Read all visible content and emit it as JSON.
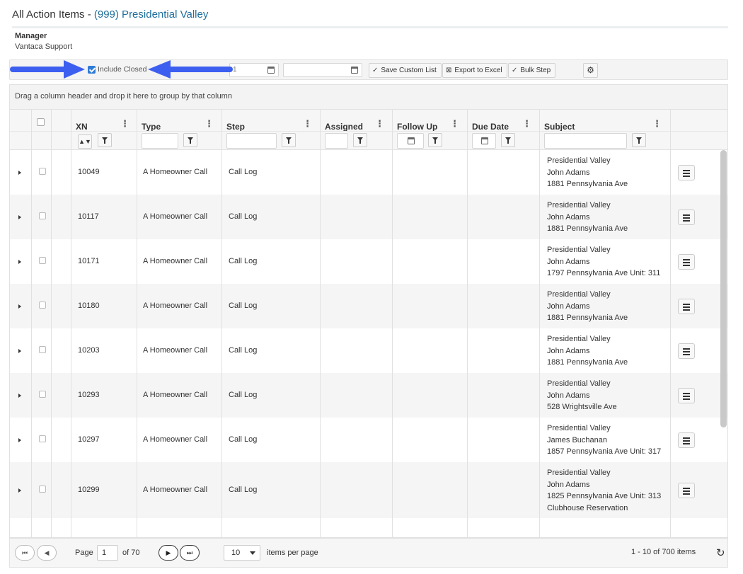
{
  "page": {
    "title_prefix": "All Action Items - ",
    "title_accent": "(999) Presidential Valley",
    "manager_label": "Manager",
    "manager_value": "Vantaca Support"
  },
  "toolbar": {
    "include_closed_label": "Include Closed",
    "include_closed_checked": true,
    "date_from_value": "1",
    "date_to_value": "",
    "save_custom_list_label": "Save Custom List",
    "export_to_excel_label": "Export to Excel",
    "bulk_step_label": "Bulk Step",
    "arrow_color": "#3d5ff0"
  },
  "group_bar_text": "Drag a column header and drop it here to group by that column",
  "columns": {
    "xn": "XN",
    "type": "Type",
    "step": "Step",
    "assigned": "Assigned",
    "follow_up": "Follow Up",
    "due_date": "Due Date",
    "subject": "Subject"
  },
  "rows": [
    {
      "xn": "10049",
      "type": "A Homeowner Call",
      "step": "Call Log",
      "subject": [
        "Presidential Valley",
        "John Adams",
        "1881 Pennsylvania Ave"
      ]
    },
    {
      "xn": "10117",
      "type": "A Homeowner Call",
      "step": "Call Log",
      "subject": [
        "Presidential Valley",
        "John Adams",
        "1881 Pennsylvania Ave"
      ]
    },
    {
      "xn": "10171",
      "type": "A Homeowner Call",
      "step": "Call Log",
      "subject": [
        "Presidential Valley",
        "John Adams",
        "1797 Pennsylvania Ave Unit: 311"
      ]
    },
    {
      "xn": "10180",
      "type": "A Homeowner Call",
      "step": "Call Log",
      "subject": [
        "Presidential Valley",
        "John Adams",
        "1881 Pennsylvania Ave"
      ]
    },
    {
      "xn": "10203",
      "type": "A Homeowner Call",
      "step": "Call Log",
      "subject": [
        "Presidential Valley",
        "John Adams",
        "1881 Pennsylvania Ave"
      ]
    },
    {
      "xn": "10293",
      "type": "A Homeowner Call",
      "step": "Call Log",
      "subject": [
        "Presidential Valley",
        "John Adams",
        "528 Wrightsville Ave"
      ]
    },
    {
      "xn": "10297",
      "type": "A Homeowner Call",
      "step": "Call Log",
      "subject": [
        "Presidential Valley",
        "James Buchanan",
        "1857 Pennsylvania Ave Unit: 317"
      ]
    },
    {
      "xn": "10299",
      "type": "A Homeowner Call",
      "step": "Call Log",
      "subject": [
        "Presidential Valley",
        "John Adams",
        "1825 Pennsylvania Ave Unit: 313",
        "Clubhouse Reservation"
      ]
    }
  ],
  "pager": {
    "page_label": "Page",
    "current_page": "1",
    "of_label": "of 70",
    "items_per_page_value": "10",
    "items_per_page_label": "items per page",
    "summary": "1 - 10 of 700 items"
  }
}
